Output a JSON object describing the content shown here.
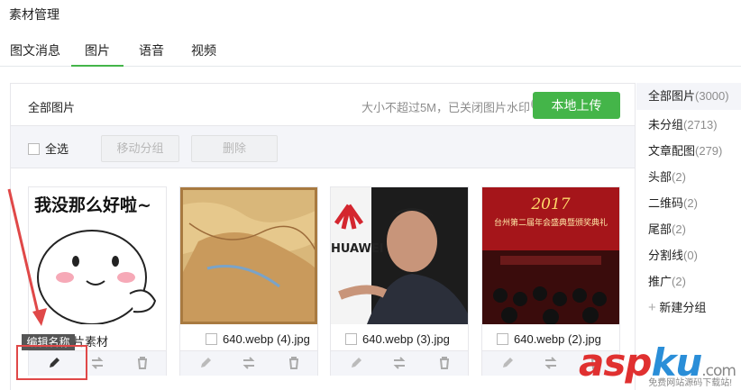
{
  "page_title": "素材管理",
  "tabs": [
    {
      "label": "图文消息",
      "active": false
    },
    {
      "label": "图片",
      "active": true
    },
    {
      "label": "语音",
      "active": false
    },
    {
      "label": "视频",
      "active": false
    }
  ],
  "panel": {
    "title": "全部图片",
    "upload_hint": "大小不超过5M，已关闭图片水印",
    "help_icon": "question-circle-icon",
    "upload_label": "本地上传"
  },
  "toolbar": {
    "select_all": "全选",
    "move_group": "移动分组",
    "delete": "删除"
  },
  "cards": [
    {
      "name": "编辑图片素材",
      "image": "emoji-sticker"
    },
    {
      "name": "640.webp (4).jpg",
      "image": "ancient-map"
    },
    {
      "name": "640.webp (3).jpg",
      "image": "huawei-speaker"
    },
    {
      "name": "640.webp (2).jpg",
      "image": "annual-meeting-2017"
    }
  ],
  "card_actions": [
    "edit-pencil-icon",
    "swap-arrows-icon",
    "trash-icon"
  ],
  "groups": [
    {
      "label": "全部图片",
      "count": "(3000)",
      "active": true
    },
    {
      "label": "未分组",
      "count": "(2713)",
      "active": false
    },
    {
      "label": "文章配图",
      "count": "(279)",
      "active": false
    },
    {
      "label": "头部",
      "count": "(2)",
      "active": false
    },
    {
      "label": "二维码",
      "count": "(2)",
      "active": false
    },
    {
      "label": "尾部",
      "count": "(2)",
      "active": false
    },
    {
      "label": "分割线",
      "count": "(0)",
      "active": false
    },
    {
      "label": "推广",
      "count": "(2)",
      "active": false
    }
  ],
  "new_group": "新建分组",
  "tooltip": "编辑名称",
  "sticker_text": "我没那么好啦~",
  "huawei_text": "HUAWEI",
  "banner_year": "2017",
  "banner_text": "台州第二届年会盛典暨颁奖典礼",
  "watermark": {
    "asp": "asp",
    "ku": "ku",
    "com": ".com",
    "sub": "免费网站源码下载站!"
  },
  "colors": {
    "accent": "#44b549",
    "annotation": "#e04848"
  }
}
